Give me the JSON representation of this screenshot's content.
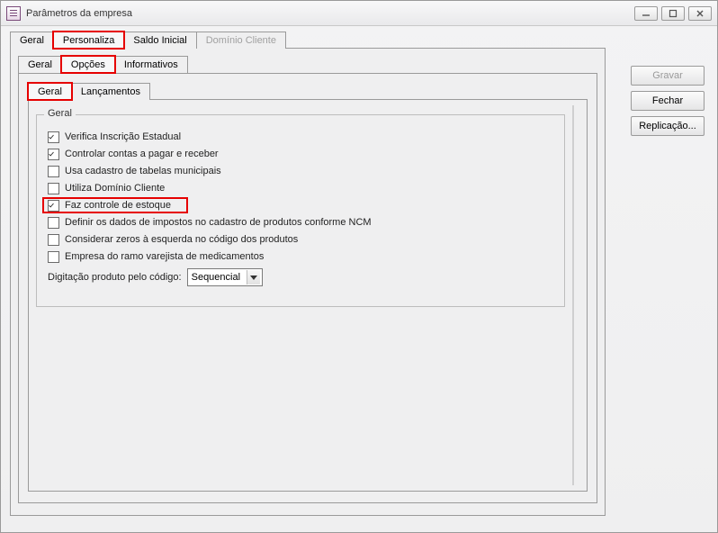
{
  "window": {
    "title": "Parâmetros da empresa"
  },
  "tabs_level1": {
    "items": [
      {
        "label": "Geral"
      },
      {
        "label": "Personaliza"
      },
      {
        "label": "Saldo Inicial"
      },
      {
        "label": "Domínio Cliente"
      }
    ]
  },
  "tabs_level2": {
    "items": [
      {
        "label": "Geral"
      },
      {
        "label": "Opções"
      },
      {
        "label": "Informativos"
      }
    ]
  },
  "tabs_level3": {
    "items": [
      {
        "label": "Geral"
      },
      {
        "label": "Lançamentos"
      }
    ]
  },
  "groupbox": {
    "title": "Geral",
    "checks": [
      {
        "label": "Verifica Inscrição Estadual",
        "checked": true
      },
      {
        "label": "Controlar contas a pagar e receber",
        "checked": true
      },
      {
        "label": "Usa cadastro de tabelas municipais",
        "checked": false
      },
      {
        "label": "Utiliza Domínio Cliente",
        "checked": false
      },
      {
        "label": "Faz controle de estoque",
        "checked": true
      },
      {
        "label": "Definir os dados de impostos no cadastro de produtos conforme NCM",
        "checked": false
      },
      {
        "label": "Considerar zeros à esquerda no código dos produtos",
        "checked": false
      },
      {
        "label": "Empresa do ramo varejista de medicamentos",
        "checked": false
      }
    ],
    "dropdown_label": "Digitação produto pelo código:",
    "dropdown_value": "Sequencial"
  },
  "buttons": {
    "gravar": "Gravar",
    "fechar": "Fechar",
    "replicacao": "Replicação..."
  }
}
